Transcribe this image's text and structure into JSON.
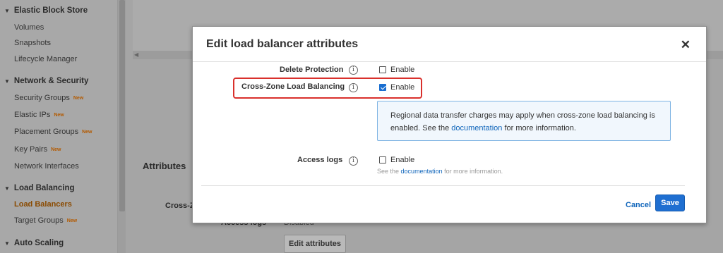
{
  "sidebar": {
    "sections": [
      {
        "title": "Elastic Block Store",
        "items": [
          {
            "label": "Volumes",
            "new": ""
          },
          {
            "label": "Snapshots",
            "new": ""
          },
          {
            "label": "Lifecycle Manager",
            "new": ""
          }
        ]
      },
      {
        "title": "Network & Security",
        "items": [
          {
            "label": "Security Groups",
            "new": "New"
          },
          {
            "label": "Elastic IPs",
            "new": "New"
          },
          {
            "label": "Placement Groups",
            "new": "New"
          },
          {
            "label": "Key Pairs",
            "new": "New"
          },
          {
            "label": "Network Interfaces",
            "new": ""
          }
        ]
      },
      {
        "title": "Load Balancing",
        "items": [
          {
            "label": "Load Balancers",
            "new": ""
          },
          {
            "label": "Target Groups",
            "new": "New"
          }
        ]
      },
      {
        "title": "Auto Scaling",
        "items": []
      }
    ]
  },
  "background": {
    "attributes_heading": "Attributes",
    "cross_zone_label_partial": "Cross-Z",
    "access_logs_label": "Access logs",
    "access_logs_value": "Disabled",
    "edit_attributes_button": "Edit attributes"
  },
  "modal": {
    "title": "Edit load balancer attributes",
    "close_glyph": "✕",
    "info_glyph": "i",
    "rows": {
      "delete_protection": {
        "label": "Delete Protection",
        "checkbox_label": "Enable",
        "checked": false
      },
      "cross_zone": {
        "label": "Cross-Zone Load Balancing",
        "checkbox_label": "Enable",
        "checked": true
      },
      "access_logs": {
        "label": "Access logs",
        "checkbox_label": "Enable",
        "checked": false
      }
    },
    "info_panel": {
      "text_before": "Regional data transfer charges may apply when cross-zone load balancing is enabled. See the",
      "link": "documentation",
      "text_after": "for more information."
    },
    "hint": {
      "before": "See the",
      "link": "documentation",
      "after": "for more information."
    },
    "cancel_label": "Cancel",
    "save_label": "Save"
  },
  "colors": {
    "accent": "#1f6fd1",
    "link": "#1166bb",
    "highlight": "#d9302c",
    "active_nav": "#8a4a00"
  },
  "icons": {
    "expand": "triangle-down-icon",
    "info": "info-icon",
    "close": "close-icon"
  }
}
